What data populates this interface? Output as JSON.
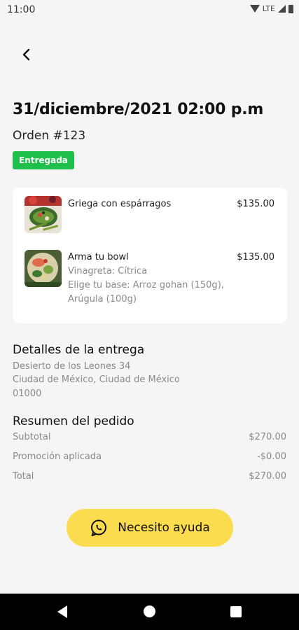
{
  "status_bar": {
    "time": "11:00",
    "network": "LTE"
  },
  "order": {
    "datetime": "31/diciembre/2021 02:00 p.m",
    "number": "Orden #123",
    "status": "Entregada",
    "status_color": "#1fbf4c"
  },
  "items": [
    {
      "name": "Griega con espárragos",
      "price": "$135.00",
      "details": [],
      "image": "salad-photo"
    },
    {
      "name": "Arma tu bowl",
      "price": "$135.00",
      "details": [
        "Vinagreta: Cítrica",
        "Elige tu base: Arroz gohan (150g),",
        "Arúgula (100g)"
      ],
      "image": "bowl-photo"
    }
  ],
  "delivery": {
    "title": "Detalles de la entrega",
    "lines": [
      "Desierto de los Leones 34",
      "Ciudad de México, Ciudad de México",
      "01000"
    ]
  },
  "summary": {
    "title": "Resumen del pedido",
    "rows": [
      {
        "label": "Subtotal",
        "value": "$270.00"
      },
      {
        "label": "Promoción aplicada",
        "value": "-$0.00"
      },
      {
        "label": "Total",
        "value": "$270.00"
      }
    ]
  },
  "help_button": {
    "label": "Necesito ayuda",
    "icon": "whatsapp-icon",
    "color": "#fbdc4e"
  }
}
